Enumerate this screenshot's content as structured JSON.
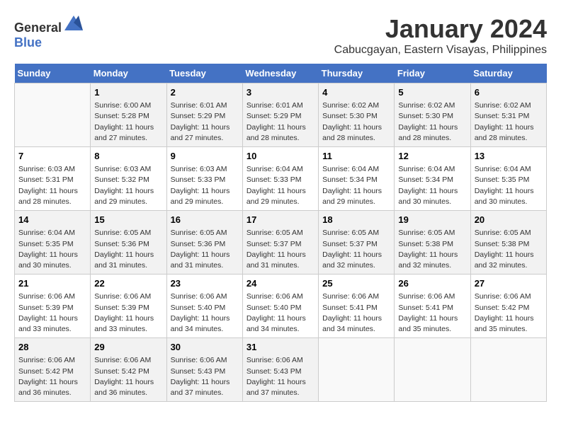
{
  "header": {
    "logo_general": "General",
    "logo_blue": "Blue",
    "title": "January 2024",
    "subtitle": "Cabucgayan, Eastern Visayas, Philippines"
  },
  "weekdays": [
    "Sunday",
    "Monday",
    "Tuesday",
    "Wednesday",
    "Thursday",
    "Friday",
    "Saturday"
  ],
  "weeks": [
    [
      {
        "day": "",
        "info": ""
      },
      {
        "day": "1",
        "info": "Sunrise: 6:00 AM\nSunset: 5:28 PM\nDaylight: 11 hours\nand 27 minutes."
      },
      {
        "day": "2",
        "info": "Sunrise: 6:01 AM\nSunset: 5:29 PM\nDaylight: 11 hours\nand 27 minutes."
      },
      {
        "day": "3",
        "info": "Sunrise: 6:01 AM\nSunset: 5:29 PM\nDaylight: 11 hours\nand 28 minutes."
      },
      {
        "day": "4",
        "info": "Sunrise: 6:02 AM\nSunset: 5:30 PM\nDaylight: 11 hours\nand 28 minutes."
      },
      {
        "day": "5",
        "info": "Sunrise: 6:02 AM\nSunset: 5:30 PM\nDaylight: 11 hours\nand 28 minutes."
      },
      {
        "day": "6",
        "info": "Sunrise: 6:02 AM\nSunset: 5:31 PM\nDaylight: 11 hours\nand 28 minutes."
      }
    ],
    [
      {
        "day": "7",
        "info": "Sunrise: 6:03 AM\nSunset: 5:31 PM\nDaylight: 11 hours\nand 28 minutes."
      },
      {
        "day": "8",
        "info": "Sunrise: 6:03 AM\nSunset: 5:32 PM\nDaylight: 11 hours\nand 29 minutes."
      },
      {
        "day": "9",
        "info": "Sunrise: 6:03 AM\nSunset: 5:33 PM\nDaylight: 11 hours\nand 29 minutes."
      },
      {
        "day": "10",
        "info": "Sunrise: 6:04 AM\nSunset: 5:33 PM\nDaylight: 11 hours\nand 29 minutes."
      },
      {
        "day": "11",
        "info": "Sunrise: 6:04 AM\nSunset: 5:34 PM\nDaylight: 11 hours\nand 29 minutes."
      },
      {
        "day": "12",
        "info": "Sunrise: 6:04 AM\nSunset: 5:34 PM\nDaylight: 11 hours\nand 30 minutes."
      },
      {
        "day": "13",
        "info": "Sunrise: 6:04 AM\nSunset: 5:35 PM\nDaylight: 11 hours\nand 30 minutes."
      }
    ],
    [
      {
        "day": "14",
        "info": "Sunrise: 6:04 AM\nSunset: 5:35 PM\nDaylight: 11 hours\nand 30 minutes."
      },
      {
        "day": "15",
        "info": "Sunrise: 6:05 AM\nSunset: 5:36 PM\nDaylight: 11 hours\nand 31 minutes."
      },
      {
        "day": "16",
        "info": "Sunrise: 6:05 AM\nSunset: 5:36 PM\nDaylight: 11 hours\nand 31 minutes."
      },
      {
        "day": "17",
        "info": "Sunrise: 6:05 AM\nSunset: 5:37 PM\nDaylight: 11 hours\nand 31 minutes."
      },
      {
        "day": "18",
        "info": "Sunrise: 6:05 AM\nSunset: 5:37 PM\nDaylight: 11 hours\nand 32 minutes."
      },
      {
        "day": "19",
        "info": "Sunrise: 6:05 AM\nSunset: 5:38 PM\nDaylight: 11 hours\nand 32 minutes."
      },
      {
        "day": "20",
        "info": "Sunrise: 6:05 AM\nSunset: 5:38 PM\nDaylight: 11 hours\nand 32 minutes."
      }
    ],
    [
      {
        "day": "21",
        "info": "Sunrise: 6:06 AM\nSunset: 5:39 PM\nDaylight: 11 hours\nand 33 minutes."
      },
      {
        "day": "22",
        "info": "Sunrise: 6:06 AM\nSunset: 5:39 PM\nDaylight: 11 hours\nand 33 minutes."
      },
      {
        "day": "23",
        "info": "Sunrise: 6:06 AM\nSunset: 5:40 PM\nDaylight: 11 hours\nand 34 minutes."
      },
      {
        "day": "24",
        "info": "Sunrise: 6:06 AM\nSunset: 5:40 PM\nDaylight: 11 hours\nand 34 minutes."
      },
      {
        "day": "25",
        "info": "Sunrise: 6:06 AM\nSunset: 5:41 PM\nDaylight: 11 hours\nand 34 minutes."
      },
      {
        "day": "26",
        "info": "Sunrise: 6:06 AM\nSunset: 5:41 PM\nDaylight: 11 hours\nand 35 minutes."
      },
      {
        "day": "27",
        "info": "Sunrise: 6:06 AM\nSunset: 5:42 PM\nDaylight: 11 hours\nand 35 minutes."
      }
    ],
    [
      {
        "day": "28",
        "info": "Sunrise: 6:06 AM\nSunset: 5:42 PM\nDaylight: 11 hours\nand 36 minutes."
      },
      {
        "day": "29",
        "info": "Sunrise: 6:06 AM\nSunset: 5:42 PM\nDaylight: 11 hours\nand 36 minutes."
      },
      {
        "day": "30",
        "info": "Sunrise: 6:06 AM\nSunset: 5:43 PM\nDaylight: 11 hours\nand 37 minutes."
      },
      {
        "day": "31",
        "info": "Sunrise: 6:06 AM\nSunset: 5:43 PM\nDaylight: 11 hours\nand 37 minutes."
      },
      {
        "day": "",
        "info": ""
      },
      {
        "day": "",
        "info": ""
      },
      {
        "day": "",
        "info": ""
      }
    ]
  ]
}
